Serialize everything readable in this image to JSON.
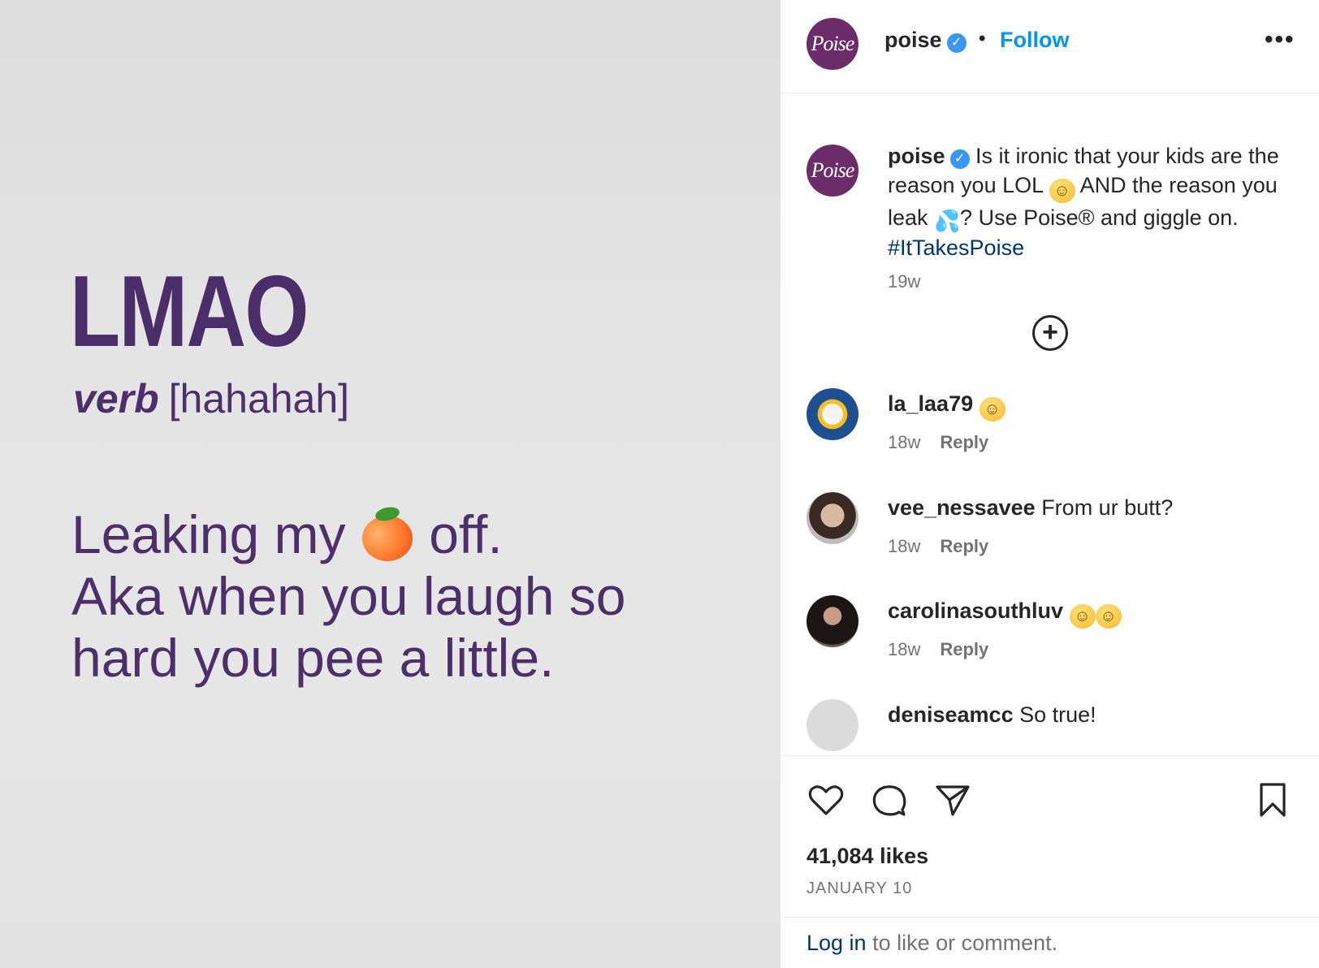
{
  "media": {
    "headword": "LMAO",
    "pos": "verb",
    "pronunciation": "[hahahah]",
    "definition_line1_before": "Leaking my",
    "definition_line1_after": "off.",
    "definition_line2": "Aka when you laugh so",
    "definition_line3": "hard you pee a little."
  },
  "header": {
    "avatar_text": "Poise",
    "username": "poise",
    "separator": "•",
    "follow_label": "Follow",
    "more_label": "•••"
  },
  "caption": {
    "username": "poise",
    "text_1": "Is it ironic that your kids are the reason you LOL",
    "text_2": "AND the reason you leak",
    "text_3": "? Use Poise® and giggle on.",
    "hashtag": "#ItTakesPoise",
    "time": "19w"
  },
  "load_more_label": "+",
  "comments": [
    {
      "username": "la_laa79",
      "text": "",
      "time": "18w",
      "reply": "Reply"
    },
    {
      "username": "vee_nessavee",
      "text": "From ur butt?",
      "time": "18w",
      "reply": "Reply"
    },
    {
      "username": "carolinasouthluv",
      "text": "",
      "time": "18w",
      "reply": "Reply"
    },
    {
      "username": "deniseamcc",
      "text": "So true!",
      "time": "",
      "reply": ""
    }
  ],
  "actions": {
    "likes": "41,084 likes",
    "date": "JANUARY 10"
  },
  "login": {
    "link": "Log in",
    "rest": " to like or comment."
  },
  "colors": {
    "brand_purple": "#6b2c69",
    "media_text": "#4e2f6b",
    "link_blue": "#0095f6",
    "hashtag": "#00376b"
  }
}
